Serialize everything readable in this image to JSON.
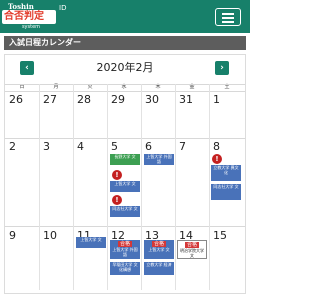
{
  "header": {
    "logo_top": "Toshin",
    "logo_chars": "合否判定",
    "logo_id": "ID",
    "logo_bottom": "system"
  },
  "section_title": "入試日程カレンダー",
  "calendar": {
    "month": "2020年2月",
    "prev_label": "‹",
    "next_label": "›",
    "weekdays": [
      "日",
      "月",
      "火",
      "水",
      "木",
      "金",
      "土"
    ],
    "weeks": [
      [
        "26",
        "27",
        "28",
        "29",
        "30",
        "31",
        "1"
      ],
      [
        "2",
        "3",
        "4",
        "5",
        "6",
        "7",
        "8"
      ],
      [
        "9",
        "10",
        "11",
        "12",
        "13",
        "14",
        "15"
      ]
    ],
    "events": {
      "feb5_1": "長野大学 文",
      "feb5_2": "上智大学 文",
      "feb5_3": "同志社大学 文",
      "feb6_1": "上智大学 外国語",
      "feb8_1": "立教大学 異文化",
      "feb8_2": "同志社大学 文",
      "feb11_1": "上智大学 文",
      "feb12_tag": "合格",
      "feb12_1": "上智大学 外国語",
      "feb12_2": "早稲田大学 文化構想",
      "feb13_tag": "合格",
      "feb13_1": "上智大学 文",
      "feb13_2": "立教大学 経済",
      "feb14_tag": "合格",
      "feb14_1": "明治学院大学 文"
    },
    "alert_symbol": "!"
  }
}
